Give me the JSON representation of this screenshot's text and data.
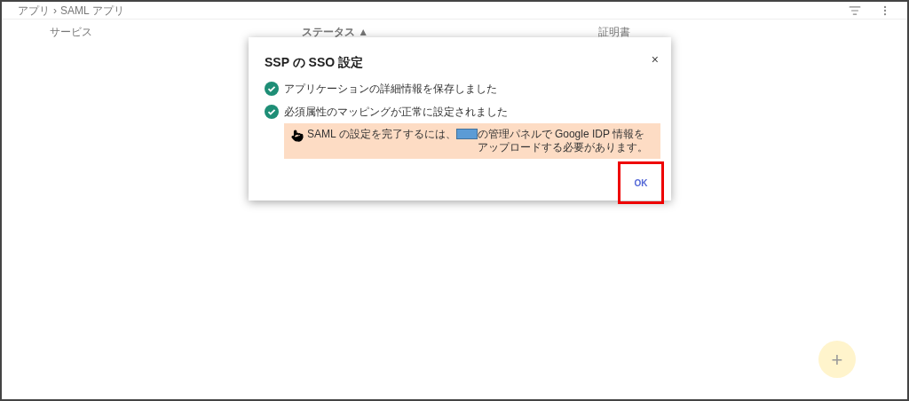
{
  "breadcrumb": [
    {
      "label": "アプリ"
    },
    {
      "label": "SAML アプリ"
    }
  ],
  "breadcrumb_separator": "›",
  "table": {
    "columns": [
      {
        "label": "サービス",
        "sorted": false
      },
      {
        "label": "ステータス",
        "sorted": true
      },
      {
        "label": "証明書",
        "sorted": false
      }
    ],
    "sort_indicator": "▲"
  },
  "dialog": {
    "title": "SSP の SSO 設定",
    "close": "×",
    "messages": [
      {
        "text": "アプリケーションの詳細情報を保存しました"
      },
      {
        "text": "必須属性のマッピングが正常に設定されました"
      }
    ],
    "notice": {
      "text_before": "SAML の設定を完了するには、",
      "text_after": "の管理パネルで Google IDP 情報をアップロードする必要があります。"
    },
    "ok_button": {
      "label": "OK",
      "highlighted": true
    }
  },
  "fab": {
    "label": "+"
  }
}
